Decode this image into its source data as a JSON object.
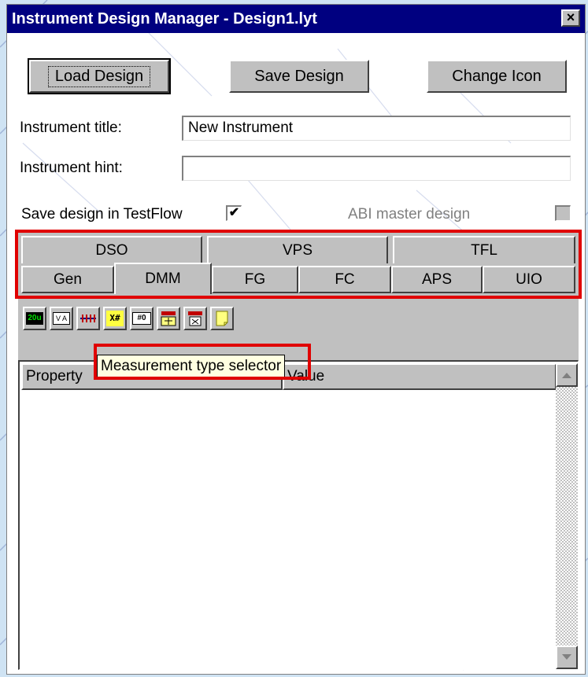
{
  "window": {
    "title": "Instrument Design Manager - Design1.lyt",
    "close_label": "×"
  },
  "toolbar": {
    "load_label": "Load Design",
    "save_label": "Save Design",
    "icon_label": "Change Icon"
  },
  "form": {
    "title_label": "Instrument title:",
    "title_value": "New Instrument",
    "hint_label": "Instrument hint:",
    "hint_value": "",
    "save_testflow_label": "Save design in TestFlow",
    "save_testflow_checked": true,
    "save_testflow_mark": "✔",
    "abi_label": "ABI master design",
    "abi_checked": false
  },
  "tabs": {
    "back_row": [
      "DSO",
      "VPS",
      "TFL"
    ],
    "front_row": [
      "Gen",
      "DMM",
      "FG",
      "FC",
      "APS",
      "UIO"
    ],
    "active": "DMM"
  },
  "tools": {
    "items": [
      {
        "icon": "display-value-icon",
        "text": "20u"
      },
      {
        "icon": "meter-units-icon",
        "text": "V A"
      },
      {
        "icon": "range-bar-icon",
        "text": ""
      },
      {
        "icon": "measurement-type-icon",
        "text": "X#"
      },
      {
        "icon": "digits-icon",
        "text": "#0"
      },
      {
        "icon": "trigger-graph-icon",
        "text": ""
      },
      {
        "icon": "trigger-clear-icon",
        "text": ""
      },
      {
        "icon": "note-icon",
        "text": ""
      }
    ]
  },
  "tooltip": {
    "text": "Measurement type selector"
  },
  "grid": {
    "col_property": "Property",
    "col_value": "Value"
  },
  "colors": {
    "titlebar": "#000080",
    "highlight": "#e00000",
    "face": "#c0c0c0",
    "tooltip_bg": "#ffffe1"
  }
}
